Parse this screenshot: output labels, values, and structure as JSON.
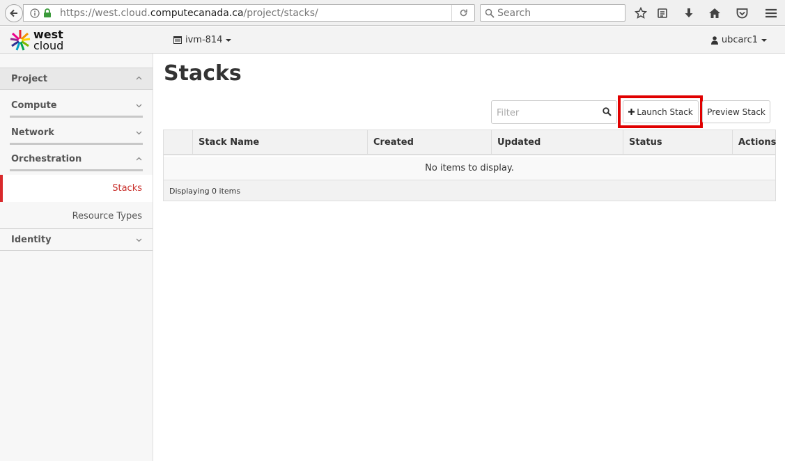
{
  "browser": {
    "url_prefix": "https://west.cloud.",
    "url_host": "computecanada.ca",
    "url_path": "/project/stacks/",
    "search_placeholder": "Search"
  },
  "header": {
    "logo_line1": "west",
    "logo_line2": "cloud",
    "project_name": "ivm-814",
    "user_name": "ubcarc1"
  },
  "sidebar": {
    "project": "Project",
    "compute": "Compute",
    "network": "Network",
    "orchestration": "Orchestration",
    "stacks": "Stacks",
    "resource_types": "Resource Types",
    "identity": "Identity"
  },
  "main": {
    "title": "Stacks",
    "filter_placeholder": "Filter",
    "launch_label": "Launch Stack",
    "preview_label": "Preview Stack",
    "columns": [
      "Stack Name",
      "Created",
      "Updated",
      "Status",
      "Actions"
    ],
    "empty_message": "No items to display.",
    "footer": "Displaying 0 items"
  },
  "colors": {
    "accent": "#d9292b",
    "highlight": "#e00000"
  }
}
